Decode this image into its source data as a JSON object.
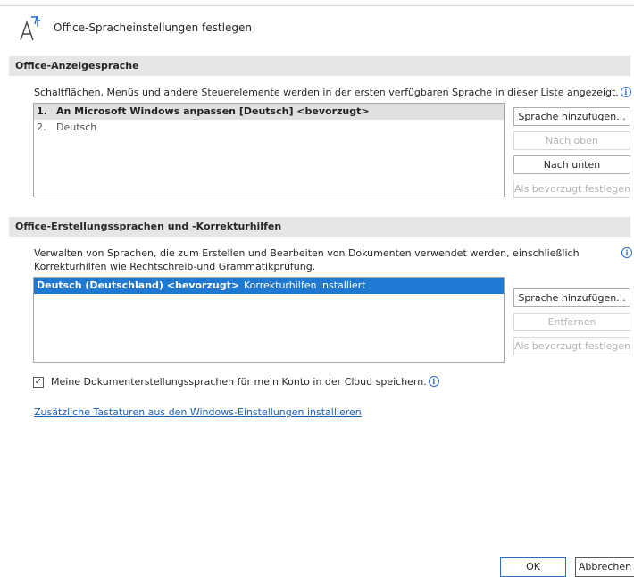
{
  "dialog": {
    "title": "Office-Spracheinstellungen festlegen"
  },
  "display_language": {
    "header": "Office-Anzeigesprache",
    "description": "Schaltflächen, Menüs und andere Steuerelemente werden in der ersten verfügbaren Sprache in dieser Liste angezeigt.",
    "items": [
      {
        "num": "1.",
        "label": "An Microsoft Windows anpassen [Deutsch] <bevorzugt>"
      },
      {
        "num": "2.",
        "label": "Deutsch"
      }
    ],
    "buttons": {
      "add": "Sprache hinzufügen...",
      "up": "Nach oben",
      "down": "Nach unten",
      "preferred": "Als bevorzugt festlegen"
    }
  },
  "authoring_language": {
    "header": "Office-Erstellungssprachen und -Korrekturhilfen",
    "description_line1": "Verwalten von Sprachen, die zum Erstellen und Bearbeiten von Dokumenten verwendet werden, einschließlich",
    "description_line2": "Korrekturhilfen wie Rechtschreib-und Grammatikprüfung.",
    "items": [
      {
        "label": "Deutsch (Deutschland) <bevorzugt>",
        "status": "Korrekturhilfen installiert"
      }
    ],
    "buttons": {
      "add": "Sprache hinzufügen...",
      "remove": "Entfernen",
      "preferred": "Als bevorzugt festlegen"
    }
  },
  "cloud_checkbox": {
    "label": "Meine Dokumenterstellungssprachen für mein Konto in der Cloud speichern.",
    "checked": true
  },
  "keyboard_link": "Zusätzliche Tastaturen aus den Windows-Einstellungen installieren",
  "footer": {
    "ok": "OK",
    "cancel": "Abbrechen"
  }
}
